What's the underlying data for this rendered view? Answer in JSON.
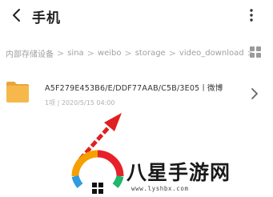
{
  "header": {
    "title": "手机",
    "back_icon": "back-arrow-icon",
    "more_icon": "more-vertical-icon"
  },
  "breadcrumb": {
    "items": [
      "内部存储设备",
      "sina",
      "weibo",
      "storage",
      "video_download"
    ],
    "view_icon": "grid-view-icon"
  },
  "file": {
    "name": "A5F279E453B6/E/DDF77AAB/C5B/3E05丨微博",
    "meta": "1项 | 2020/5/15 04:00",
    "icon": "folder-icon",
    "folder_color": "#F7B84B"
  },
  "annotation": {
    "arrow_color": "#E02020"
  },
  "watermark": {
    "brand": "八星手游网",
    "url": "www.lyshbx.com"
  }
}
